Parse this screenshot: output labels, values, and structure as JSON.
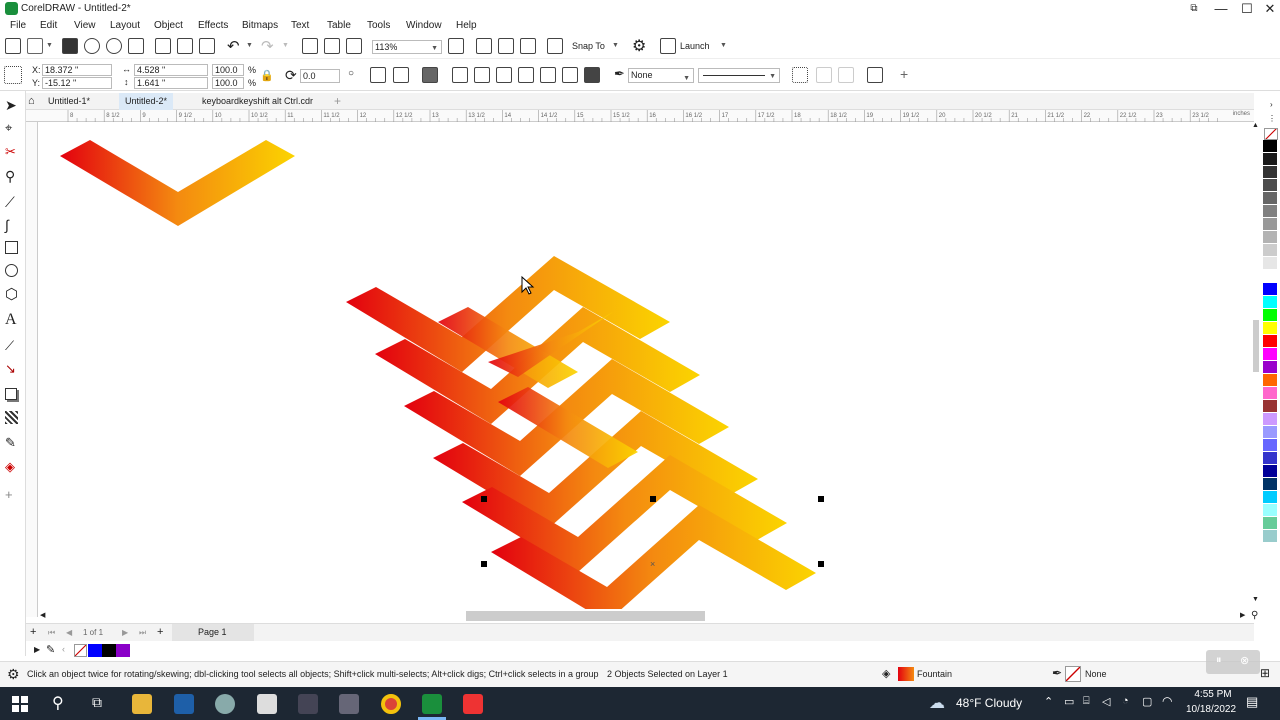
{
  "window": {
    "title": "CorelDRAW - Untitled-2*",
    "minimize": "—",
    "maximize": "☐",
    "close": "✕"
  },
  "menu": [
    "File",
    "Edit",
    "View",
    "Layout",
    "Object",
    "Effects",
    "Bitmaps",
    "Text",
    "Table",
    "Tools",
    "Window",
    "Help"
  ],
  "toolbar": {
    "zoom": "113%",
    "snap_to": "Snap To",
    "launch": "Launch"
  },
  "properties": {
    "x": "18.372 \"",
    "y": "-15.12 \"",
    "width": "4.528 \"",
    "height": "1.641 \"",
    "scale_x": "100.0",
    "scale_y": "100.0",
    "pct": "%",
    "angle": "0.0",
    "outline": "None"
  },
  "doc_tabs": [
    "Untitled-1*",
    "Untitled-2*",
    "keyboardkeyshift alt Ctrl.cdr"
  ],
  "active_tab": 1,
  "ruler_unit": "inches",
  "ruler_labels": [
    "8",
    "8 1/2",
    "9",
    "9 1/2",
    "10",
    "10 1/2",
    "11",
    "11 1/2",
    "12",
    "12 1/2",
    "13",
    "13 1/2",
    "14",
    "14 1/2",
    "15",
    "15 1/2",
    "16",
    "16 1/2",
    "17",
    "17 1/2",
    "18",
    "18 1/2",
    "19",
    "19 1/2",
    "20",
    "20 1/2",
    "21",
    "21 1/2",
    "22",
    "22 1/2",
    "23",
    "23 1/2"
  ],
  "pages": {
    "counter": "1 of 1",
    "tab": "Page 1"
  },
  "status": {
    "hint": "Click an object twice for rotating/skewing; dbl-clicking tool selects all objects; Shift+click multi-selects; Alt+click digs; Ctrl+click selects in a group",
    "selection": "2 Objects Selected on Layer 1",
    "fill": "Fountain",
    "outline": "None"
  },
  "palette_colors": [
    "#000000",
    "#1a1a1a",
    "#333333",
    "#4d4d4d",
    "#666666",
    "#808080",
    "#999999",
    "#b3b3b3",
    "#cccccc",
    "#e6e6e6",
    "#ffffff",
    "#0000ff",
    "#00ffff",
    "#00ff00",
    "#ffff00",
    "#ff0000",
    "#ff00ff",
    "#9900cc",
    "#ff6600",
    "#ff66cc",
    "#993333",
    "#cc99ff",
    "#9999ff",
    "#6666ff",
    "#3333cc",
    "#000099",
    "#003366",
    "#00ccff",
    "#99ffff",
    "#66cc99",
    "#99cccc"
  ],
  "colorbar_swatches": [
    "#0000ff",
    "#000000",
    "#8a00c8"
  ],
  "taskbar": {
    "weather": "48°F  Cloudy",
    "time": "4:55 PM",
    "date": "10/18/2022"
  }
}
